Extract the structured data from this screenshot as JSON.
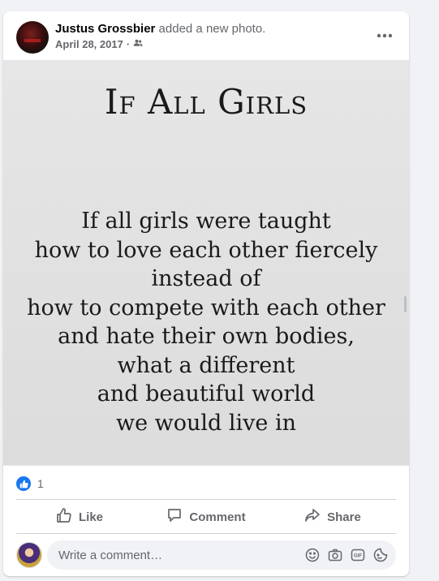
{
  "post": {
    "author": "Justus Grossbier",
    "action_text": " added a new photo.",
    "date": "April 28, 2017",
    "separator": "·",
    "audience_icon": "friends-icon",
    "more_icon": "more-options-icon"
  },
  "photo": {
    "title": "If All Girls",
    "lines": [
      "If all girls were taught",
      "how to love each other fiercely",
      "instead of",
      "how to compete with each other",
      "and hate their own bodies,",
      "what a different",
      "and beautiful world",
      "we would live in"
    ]
  },
  "reactions": {
    "icon": "like-reaction-icon",
    "count": "1"
  },
  "actions": {
    "like": "Like",
    "comment": "Comment",
    "share": "Share"
  },
  "comment_box": {
    "placeholder": "Write a comment…",
    "icons": [
      "emoji-icon",
      "camera-icon",
      "gif-icon",
      "sticker-icon"
    ]
  },
  "colors": {
    "accent": "#1877f2",
    "secondary_text": "#65676b",
    "primary_text": "#050505",
    "page_bg": "#f0f2f5"
  }
}
